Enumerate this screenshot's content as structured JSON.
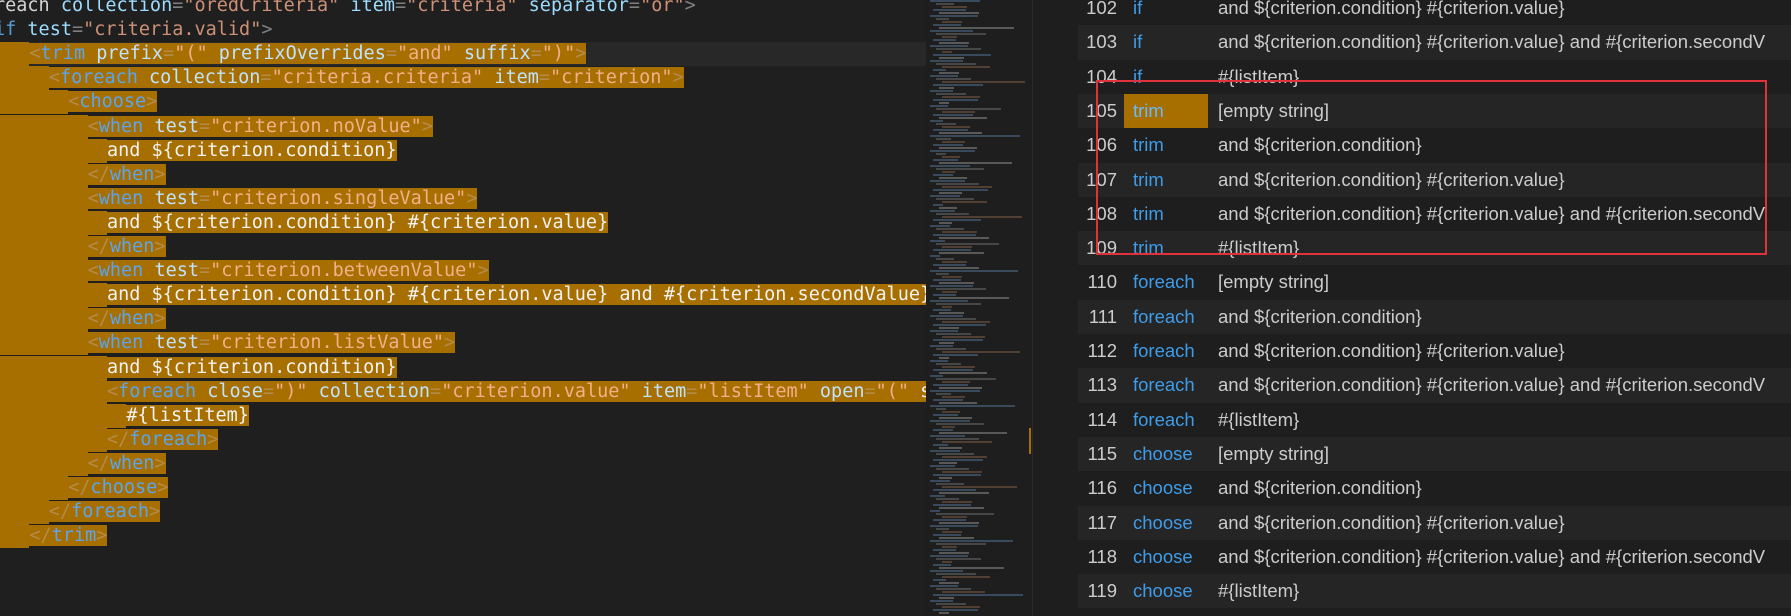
{
  "editor": {
    "lines": [
      {
        "indent": 0,
        "tokens": [
          [
            "text",
            "reach "
          ],
          [
            "attr",
            "collection"
          ],
          [
            "punct",
            "="
          ],
          [
            "str",
            "\"oredCriteria\""
          ],
          [
            "text",
            " "
          ],
          [
            "attr",
            "item"
          ],
          [
            "punct",
            "="
          ],
          [
            "str",
            "\"criteria\""
          ],
          [
            "text",
            " "
          ],
          [
            "attr",
            "separator"
          ],
          [
            "punct",
            "="
          ],
          [
            "str",
            "\"or\""
          ],
          [
            "punct",
            ">"
          ]
        ],
        "hl": false
      },
      {
        "indent": 0,
        "tokens": [
          [
            "tag",
            "if"
          ],
          [
            "text",
            " "
          ],
          [
            "attr",
            "test"
          ],
          [
            "punct",
            "="
          ],
          [
            "str",
            "\"criteria.valid\""
          ],
          [
            "punct",
            ">"
          ]
        ],
        "hl": false
      },
      {
        "indent": 1,
        "tokens": [
          [
            "punct",
            "<"
          ],
          [
            "tag",
            "trim"
          ],
          [
            "text",
            " "
          ],
          [
            "attr",
            "prefix"
          ],
          [
            "punct",
            "="
          ],
          [
            "str",
            "\"(\""
          ],
          [
            "text",
            " "
          ],
          [
            "attr",
            "prefixOverrides"
          ],
          [
            "punct",
            "="
          ],
          [
            "str",
            "\"and\""
          ],
          [
            "text",
            " "
          ],
          [
            "attr",
            "suffix"
          ],
          [
            "punct",
            "="
          ],
          [
            "str",
            "\")\""
          ],
          [
            "punct",
            ">"
          ]
        ],
        "hl": true,
        "current": true
      },
      {
        "indent": 2,
        "tokens": [
          [
            "punct",
            "<"
          ],
          [
            "tag",
            "foreach"
          ],
          [
            "text",
            " "
          ],
          [
            "attr",
            "collection"
          ],
          [
            "punct",
            "="
          ],
          [
            "str",
            "\"criteria.criteria\""
          ],
          [
            "text",
            " "
          ],
          [
            "attr",
            "item"
          ],
          [
            "punct",
            "="
          ],
          [
            "str",
            "\"criterion\""
          ],
          [
            "punct",
            ">"
          ]
        ],
        "hl": true
      },
      {
        "indent": 3,
        "tokens": [
          [
            "punct",
            "<"
          ],
          [
            "tag",
            "choose"
          ],
          [
            "punct",
            ">"
          ]
        ],
        "hl": true
      },
      {
        "indent": 4,
        "tokens": [
          [
            "punct",
            "<"
          ],
          [
            "tag",
            "when"
          ],
          [
            "text",
            " "
          ],
          [
            "attr",
            "test"
          ],
          [
            "punct",
            "="
          ],
          [
            "str",
            "\"criterion.noValue\""
          ],
          [
            "punct",
            ">"
          ]
        ],
        "hl": true
      },
      {
        "indent": 5,
        "tokens": [
          [
            "text",
            "and ${criterion.condition}"
          ]
        ],
        "hl": true
      },
      {
        "indent": 4,
        "tokens": [
          [
            "punct",
            "</"
          ],
          [
            "tag",
            "when"
          ],
          [
            "punct",
            ">"
          ]
        ],
        "hl": true
      },
      {
        "indent": 4,
        "tokens": [
          [
            "punct",
            "<"
          ],
          [
            "tag",
            "when"
          ],
          [
            "text",
            " "
          ],
          [
            "attr",
            "test"
          ],
          [
            "punct",
            "="
          ],
          [
            "str",
            "\"criterion.singleValue\""
          ],
          [
            "punct",
            ">"
          ]
        ],
        "hl": true
      },
      {
        "indent": 5,
        "tokens": [
          [
            "text",
            "and ${criterion.condition} #{criterion.value}"
          ]
        ],
        "hl": true
      },
      {
        "indent": 4,
        "tokens": [
          [
            "punct",
            "</"
          ],
          [
            "tag",
            "when"
          ],
          [
            "punct",
            ">"
          ]
        ],
        "hl": true
      },
      {
        "indent": 4,
        "tokens": [
          [
            "punct",
            "<"
          ],
          [
            "tag",
            "when"
          ],
          [
            "text",
            " "
          ],
          [
            "attr",
            "test"
          ],
          [
            "punct",
            "="
          ],
          [
            "str",
            "\"criterion.betweenValue\""
          ],
          [
            "punct",
            ">"
          ]
        ],
        "hl": true
      },
      {
        "indent": 5,
        "tokens": [
          [
            "text",
            "and ${criterion.condition} #{criterion.value} and #{criterion.secondValue}"
          ]
        ],
        "hl": true
      },
      {
        "indent": 4,
        "tokens": [
          [
            "punct",
            "</"
          ],
          [
            "tag",
            "when"
          ],
          [
            "punct",
            ">"
          ]
        ],
        "hl": true
      },
      {
        "indent": 4,
        "tokens": [
          [
            "punct",
            "<"
          ],
          [
            "tag",
            "when"
          ],
          [
            "text",
            " "
          ],
          [
            "attr",
            "test"
          ],
          [
            "punct",
            "="
          ],
          [
            "str",
            "\"criterion.listValue\""
          ],
          [
            "punct",
            ">"
          ]
        ],
        "hl": true
      },
      {
        "indent": 5,
        "tokens": [
          [
            "text",
            "and ${criterion.condition}"
          ]
        ],
        "hl": true
      },
      {
        "indent": 5,
        "tokens": [
          [
            "punct",
            "<"
          ],
          [
            "tag",
            "foreach"
          ],
          [
            "text",
            " "
          ],
          [
            "attr",
            "close"
          ],
          [
            "punct",
            "="
          ],
          [
            "str",
            "\")\""
          ],
          [
            "text",
            " "
          ],
          [
            "attr",
            "collection"
          ],
          [
            "punct",
            "="
          ],
          [
            "str",
            "\"criterion.value\""
          ],
          [
            "text",
            " "
          ],
          [
            "attr",
            "item"
          ],
          [
            "punct",
            "="
          ],
          [
            "str",
            "\"listItem\""
          ],
          [
            "text",
            " "
          ],
          [
            "attr",
            "open"
          ],
          [
            "punct",
            "="
          ],
          [
            "str",
            "\"(\""
          ],
          [
            "text",
            " s"
          ]
        ],
        "hl": true
      },
      {
        "indent": 6,
        "tokens": [
          [
            "text",
            "#{listItem}"
          ]
        ],
        "hl": true
      },
      {
        "indent": 5,
        "tokens": [
          [
            "punct",
            "</"
          ],
          [
            "tag",
            "foreach"
          ],
          [
            "punct",
            ">"
          ]
        ],
        "hl": true
      },
      {
        "indent": 4,
        "tokens": [
          [
            "punct",
            "</"
          ],
          [
            "tag",
            "when"
          ],
          [
            "punct",
            ">"
          ]
        ],
        "hl": true
      },
      {
        "indent": 3,
        "tokens": [
          [
            "punct",
            "</"
          ],
          [
            "tag",
            "choose"
          ],
          [
            "punct",
            ">"
          ]
        ],
        "hl": true
      },
      {
        "indent": 2,
        "tokens": [
          [
            "punct",
            "</"
          ],
          [
            "tag",
            "foreach"
          ],
          [
            "punct",
            ">"
          ]
        ],
        "hl": true
      },
      {
        "indent": 1,
        "tokens": [
          [
            "punct",
            "</"
          ],
          [
            "tag",
            "trim"
          ],
          [
            "punct",
            ">"
          ]
        ],
        "hl": true
      }
    ]
  },
  "results": {
    "rows": [
      {
        "num": "102",
        "kw": "if",
        "val": "and ${criterion.condition} #{criterion.value}"
      },
      {
        "num": "103",
        "kw": "if",
        "val": "and ${criterion.condition} #{criterion.value} and #{criterion.secondV"
      },
      {
        "num": "104",
        "kw": "if",
        "val": "#{listItem}"
      },
      {
        "num": "105",
        "kw": "trim",
        "val": "[empty string]",
        "selected": true
      },
      {
        "num": "106",
        "kw": "trim",
        "val": "and ${criterion.condition}"
      },
      {
        "num": "107",
        "kw": "trim",
        "val": "and ${criterion.condition} #{criterion.value}"
      },
      {
        "num": "108",
        "kw": "trim",
        "val": "and ${criterion.condition} #{criterion.value} and #{criterion.secondV"
      },
      {
        "num": "109",
        "kw": "trim",
        "val": "#{listItem}"
      },
      {
        "num": "110",
        "kw": "foreach",
        "val": "[empty string]"
      },
      {
        "num": "111",
        "kw": "foreach",
        "val": "and ${criterion.condition}"
      },
      {
        "num": "112",
        "kw": "foreach",
        "val": "and ${criterion.condition} #{criterion.value}"
      },
      {
        "num": "113",
        "kw": "foreach",
        "val": "and ${criterion.condition} #{criterion.value} and #{criterion.secondV"
      },
      {
        "num": "114",
        "kw": "foreach",
        "val": "#{listItem}"
      },
      {
        "num": "115",
        "kw": "choose",
        "val": "[empty string]"
      },
      {
        "num": "116",
        "kw": "choose",
        "val": "and ${criterion.condition}"
      },
      {
        "num": "117",
        "kw": "choose",
        "val": "and ${criterion.condition} #{criterion.value}"
      },
      {
        "num": "118",
        "kw": "choose",
        "val": "and ${criterion.condition} #{criterion.value} and #{criterion.secondV"
      },
      {
        "num": "119",
        "kw": "choose",
        "val": "#{listItem}"
      }
    ]
  },
  "colors": {
    "match_highlight": "#a66f00",
    "keyword_blue": "#3f9ce8",
    "annotation_box": "#e0323a"
  }
}
